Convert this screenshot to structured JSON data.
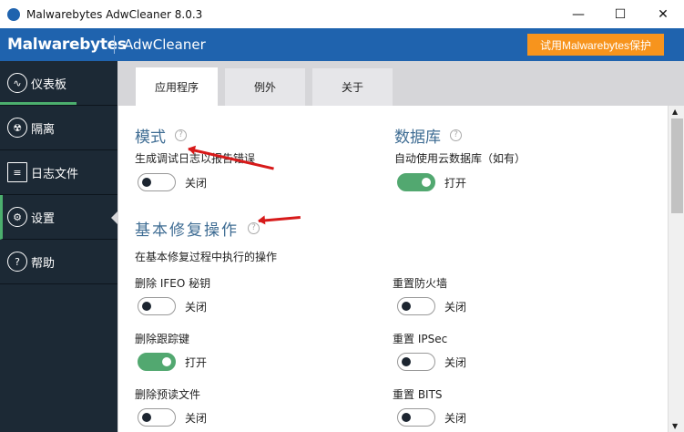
{
  "window": {
    "title": "Malwarebytes AdwCleaner 8.0.3",
    "minimize": "—",
    "maximize": "☐",
    "close": "✕"
  },
  "header": {
    "logo": "Malwarebytes",
    "product": "AdwCleaner",
    "try_button": "试用Malwarebytes保护"
  },
  "sidebar": {
    "items": [
      {
        "label": "仪表板",
        "icon": "pulse-icon"
      },
      {
        "label": "隔离",
        "icon": "radiation-icon"
      },
      {
        "label": "日志文件",
        "icon": "document-icon"
      },
      {
        "label": "设置",
        "icon": "gear-icon",
        "active": true
      },
      {
        "label": "帮助",
        "icon": "help-icon"
      }
    ]
  },
  "tabs": [
    "应用程序",
    "例外",
    "关于"
  ],
  "mode": {
    "title": "模式",
    "desc": "生成调试日志以报告错误",
    "toggle": {
      "on": false,
      "label": "关闭"
    }
  },
  "database": {
    "title": "数据库",
    "desc": "自动使用云数据库（如有）",
    "toggle": {
      "on": true,
      "label": "打开"
    }
  },
  "basic": {
    "title": "基本修复操作",
    "desc": "在基本修复过程中执行的操作",
    "items": [
      {
        "label": "删除 IFEO 秘钥",
        "on": false,
        "state": "关闭"
      },
      {
        "label": "重置防火墙",
        "on": false,
        "state": "关闭"
      },
      {
        "label": "删除跟踪键",
        "on": true,
        "state": "打开"
      },
      {
        "label": "重置 IPSec",
        "on": false,
        "state": "关闭"
      },
      {
        "label": "删除预读文件",
        "on": false,
        "state": "关闭"
      },
      {
        "label": "重置 BITS",
        "on": false,
        "state": "关闭"
      }
    ]
  },
  "help_glyph": "?",
  "colors": {
    "header": "#1f63ae",
    "accent_orange": "#f7941d",
    "toggle_on": "#52a870",
    "sidebar": "#1c2935",
    "heading": "#3e6c93"
  }
}
